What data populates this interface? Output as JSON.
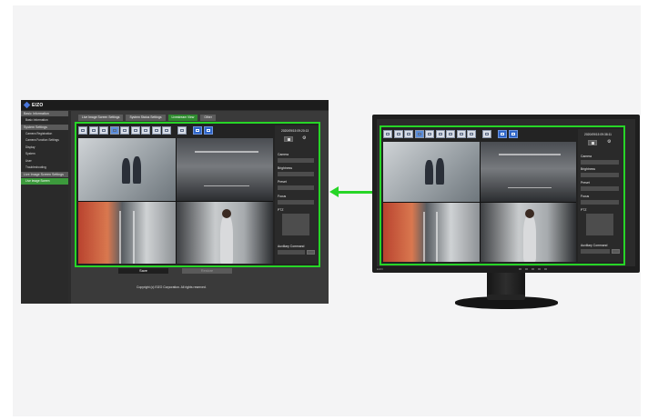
{
  "brand": {
    "logo_text": "EIZO"
  },
  "sidebar": {
    "groups": [
      {
        "label": "Basic Information",
        "items": [
          {
            "label": "Basic Information",
            "active": false
          }
        ]
      },
      {
        "label": "System Settings",
        "items": [
          {
            "label": "Camera Registration",
            "active": false
          },
          {
            "label": "Camera Function Settings",
            "active": false
          },
          {
            "label": "Display",
            "active": false
          },
          {
            "label": "System",
            "active": false
          },
          {
            "label": "User",
            "active": false
          },
          {
            "label": "Troubleshooting",
            "active": false
          }
        ]
      },
      {
        "label": "Live Image Screen Settings",
        "items": [
          {
            "label": "Live Image Screen",
            "active": true
          }
        ]
      }
    ]
  },
  "tabs": [
    {
      "label": "Live Image Screen Settings",
      "active": false
    },
    {
      "label": "System Status Settings",
      "active": false
    },
    {
      "label": "Livestream View",
      "active": true
    },
    {
      "label": "Other",
      "active": false
    }
  ],
  "viewer_left": {
    "datetime": "2020/09/15 09:20:13",
    "labels": {
      "camera": "Camera",
      "brightness": "Brightness",
      "preset": "Preset",
      "focus": "Focus",
      "ptz": "PTZ",
      "auxiliary": "Auxiliary Command"
    }
  },
  "viewer_right": {
    "datetime": "2020/09/15 09:38:11",
    "labels": {
      "camera": "Camera",
      "brightness": "Brightness",
      "preset": "Preset",
      "focus": "Focus",
      "ptz": "PTZ",
      "auxiliary": "Auxiliary Command"
    }
  },
  "footer": {
    "save_label": "Save",
    "restore_label": "Restore",
    "copyright": "Copyright (c) EIZO Corporation. All rights reserved."
  },
  "monitor": {
    "bezel_logo": "EIZO"
  },
  "colors": {
    "highlight": "#27d527",
    "accent_tab": "#2f8a2f",
    "toolbar_blue": "#2f66c9"
  },
  "icons": [
    "eizo-logo-icon",
    "layout-grid-icon",
    "gear-icon",
    "stop-icon",
    "arrow-left-icon"
  ]
}
